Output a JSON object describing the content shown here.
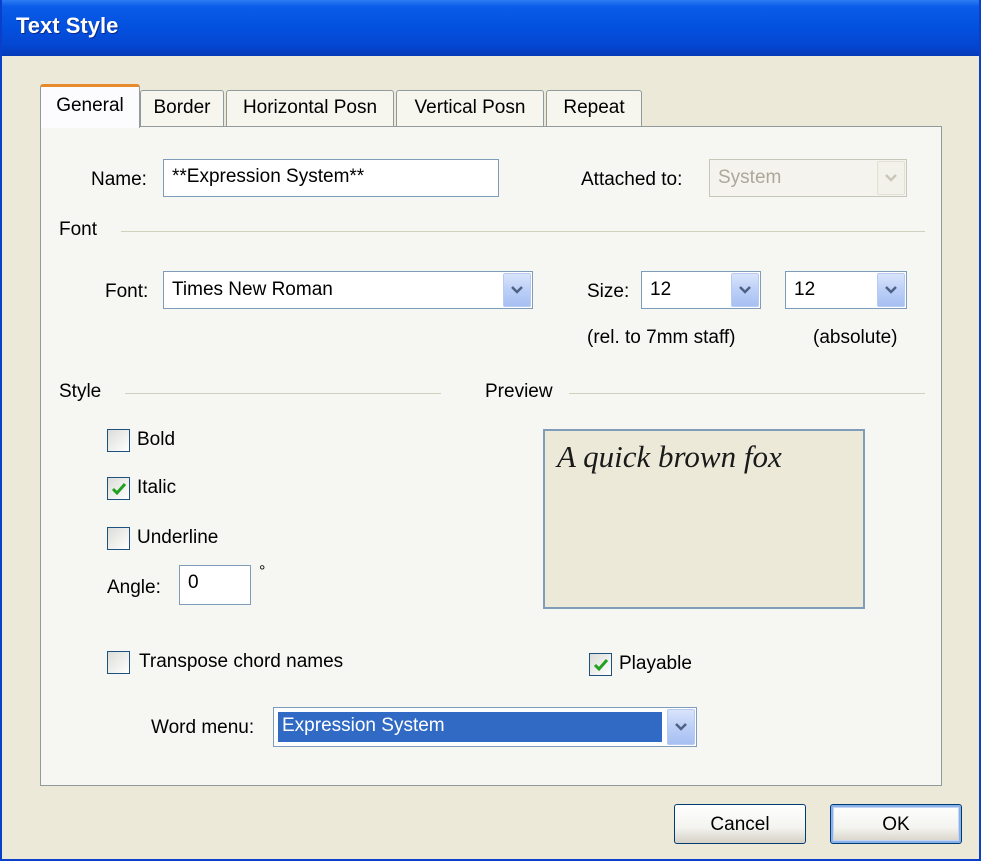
{
  "window": {
    "title": "Text Style"
  },
  "tabs": [
    {
      "label": "General"
    },
    {
      "label": "Border"
    },
    {
      "label": "Horizontal Posn"
    },
    {
      "label": "Vertical Posn"
    },
    {
      "label": "Repeat"
    }
  ],
  "general": {
    "name_label": "Name:",
    "name_value": "**Expression System**",
    "attached_label": "Attached to:",
    "attached_value": "System",
    "font_group": "Font",
    "font_label": "Font:",
    "font_value": "Times New Roman",
    "size_label": "Size:",
    "size_rel_value": "12",
    "size_abs_value": "12",
    "size_rel_caption": "(rel. to 7mm staff)",
    "size_abs_caption": "(absolute)",
    "style_group": "Style",
    "bold_label": "Bold",
    "bold_checked": false,
    "italic_label": "Italic",
    "italic_checked": true,
    "underline_label": "Underline",
    "underline_checked": false,
    "angle_label": "Angle:",
    "angle_value": "0",
    "angle_unit": "°",
    "preview_group": "Preview",
    "preview_text": "A quick brown fox",
    "transpose_label": "Transpose chord names",
    "transpose_checked": false,
    "playable_label": "Playable",
    "playable_checked": true,
    "word_menu_label": "Word menu:",
    "word_menu_value": "Expression System"
  },
  "buttons": {
    "cancel": "Cancel",
    "ok": "OK"
  },
  "colors": {
    "titlebar": "#0350de",
    "active_tab_accent": "#e68b2c",
    "selection": "#316ac5",
    "checkmark": "#21a121"
  }
}
